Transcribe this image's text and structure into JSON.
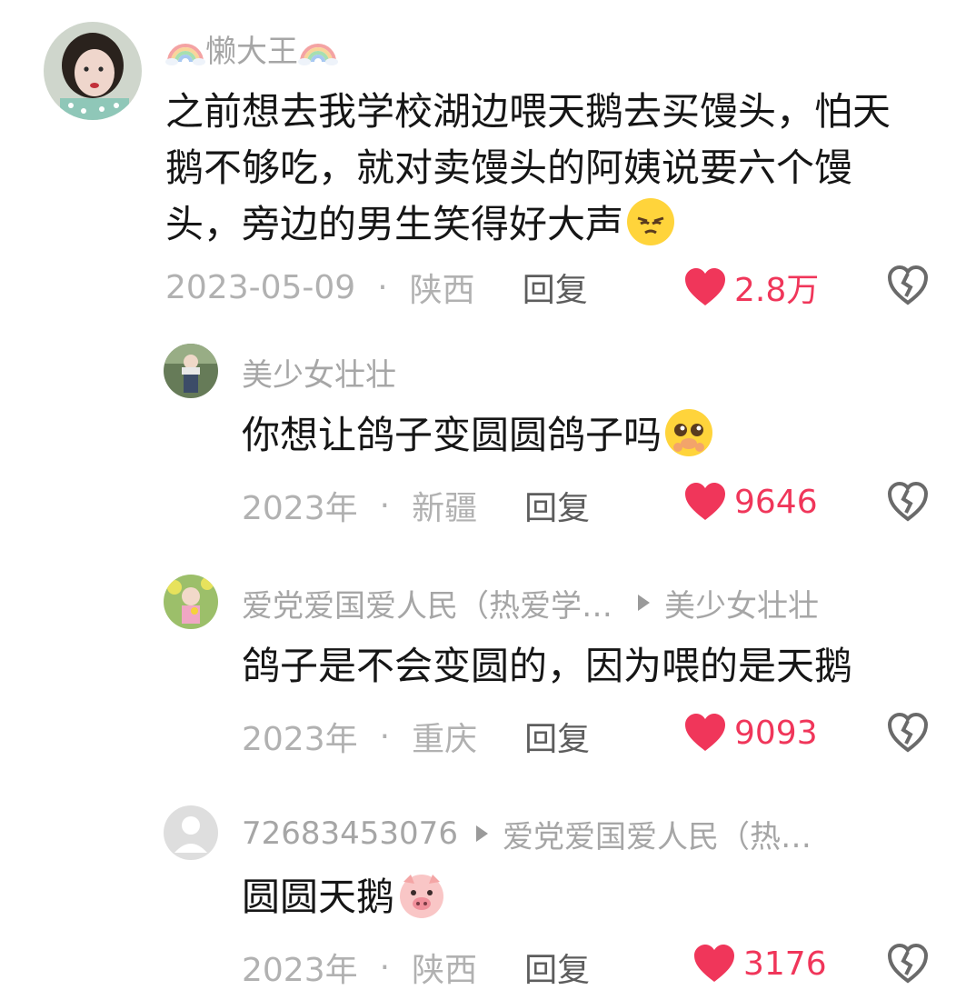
{
  "comments": [
    {
      "username": "懒大王",
      "text": "之前想去我学校湖边喂天鹅去买馒头，怕天鹅不够吃，就对卖馒头的阿姨说要六个馒头，旁边的男生笑得好大声",
      "date": "2023-05-09",
      "location": "陕西",
      "reply_label": "回复",
      "likes": "2.8万",
      "emoji": "smirk-face"
    },
    {
      "username": "美少女壮壮",
      "text": "你想让鸽子变圆圆鸽子吗",
      "date": "2023年",
      "location": "新疆",
      "reply_label": "回复",
      "likes": "9646",
      "emoji": "pleading-face"
    },
    {
      "username": "爱党爱国爱人民（热爱学…",
      "reply_to": "美少女壮壮",
      "text": "鸽子是不会变圆的，因为喂的是天鹅",
      "date": "2023年",
      "location": "重庆",
      "reply_label": "回复",
      "likes": "9093"
    },
    {
      "username": "72683453076",
      "reply_to": "爱党爱国爱人民（热…",
      "text": "圆圆天鹅",
      "date": "2023年",
      "location": "陕西",
      "reply_label": "回复",
      "likes": "3176",
      "emoji": "pig-face"
    }
  ],
  "colors": {
    "like_red": "#f0365a",
    "meta_gray": "#b1b1b1",
    "name_gray": "#a6a6a6"
  },
  "icons": [
    "rainbow-icon",
    "heart-icon",
    "broken-heart-icon",
    "reply-arrow-icon"
  ]
}
